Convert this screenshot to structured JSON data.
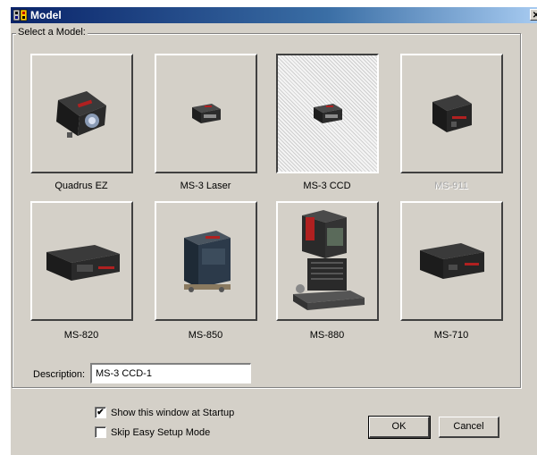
{
  "window": {
    "title": "Model"
  },
  "group": {
    "label": "Select a Model:"
  },
  "models": [
    {
      "name": "Quadrus EZ",
      "icon": "quadrus-ez-scanner-image",
      "state": "normal"
    },
    {
      "name": "MS-3 Laser",
      "icon": "ms-3-laser-scanner-image",
      "state": "normal"
    },
    {
      "name": "MS-3 CCD",
      "icon": "ms-3-ccd-scanner-image",
      "state": "selected"
    },
    {
      "name": "MS-911",
      "icon": "ms-911-scanner-image",
      "state": "disabled"
    },
    {
      "name": "MS-820",
      "icon": "ms-820-scanner-image",
      "state": "normal"
    },
    {
      "name": "MS-850",
      "icon": "ms-850-scanner-image",
      "state": "normal"
    },
    {
      "name": "MS-880",
      "icon": "ms-880-scanner-image",
      "state": "normal"
    },
    {
      "name": "MS-710",
      "icon": "ms-710-scanner-image",
      "state": "normal"
    }
  ],
  "description": {
    "label": "Description:",
    "value": "MS-3 CCD-1"
  },
  "options": {
    "show_startup": {
      "label": "Show this window at Startup",
      "checked": true
    },
    "skip_easy_setup": {
      "label": "Skip Easy Setup Mode",
      "checked": false
    }
  },
  "buttons": {
    "ok": "OK",
    "cancel": "Cancel"
  },
  "colors": {
    "titlebar": "#0a246a",
    "face": "#d4d0c8"
  }
}
